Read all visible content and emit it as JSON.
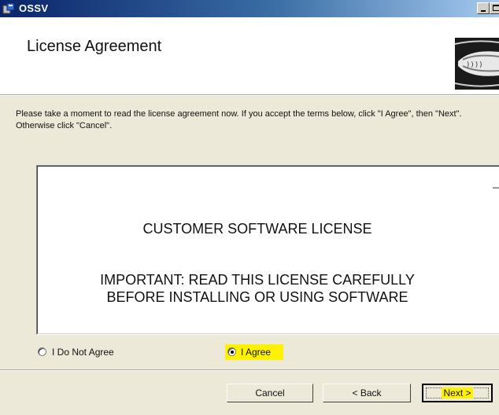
{
  "window": {
    "title": "OSSV"
  },
  "header": {
    "title": "License Agreement"
  },
  "instructions": "Please take a moment to read the license agreement now. If you accept the terms below, click \"I Agree\", then \"Next\". Otherwise click \"Cancel\".",
  "license": {
    "heading": "CUSTOMER SOFTWARE LICENSE",
    "important_line1": "IMPORTANT:  READ THIS LICENSE CAREFULLY",
    "important_line2": "BEFORE INSTALLING OR USING SOFTWARE"
  },
  "options": {
    "disagree_label": "I Do Not Agree",
    "agree_label": "I Agree",
    "selected": "agree"
  },
  "buttons": {
    "cancel": "Cancel",
    "back": "< Back",
    "next": "Next >"
  },
  "colors": {
    "highlight": "#fff200",
    "titlebar_start": "#0a246a",
    "titlebar_end": "#a6caf0"
  }
}
